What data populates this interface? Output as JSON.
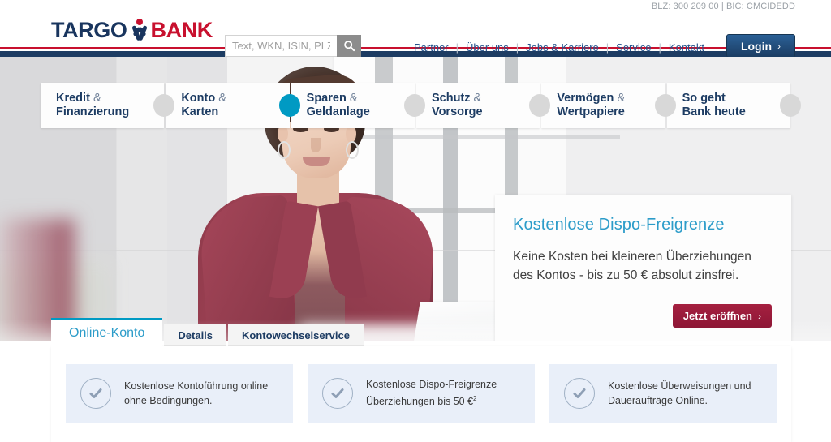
{
  "utility": {
    "blz_bic": "BLZ: 300 209 00 | BIC: CMCIDEDD"
  },
  "brand": {
    "name_part1": "TARGO",
    "name_part2": "BANK",
    "navy": "#1d3c63",
    "red": "#c8102e",
    "accent_cyan": "#009ac3"
  },
  "search": {
    "placeholder": "Text, WKN, ISIN, PLZ",
    "value": "",
    "button_icon": "search-icon"
  },
  "topnav": {
    "items": [
      {
        "label": "Partner"
      },
      {
        "label": "Über uns"
      },
      {
        "label": "Jobs & Karriere"
      },
      {
        "label": "Service"
      },
      {
        "label": "Kontakt"
      }
    ],
    "separator": "|",
    "login_label": "Login",
    "login_chevron": "›"
  },
  "mainnav": {
    "items": [
      {
        "line1": "Kredit",
        "amp": "&",
        "line2": "Finanzierung",
        "knob": "gray"
      },
      {
        "line1": "Konto",
        "amp": "&",
        "line2": "Karten",
        "knob": "cyan"
      },
      {
        "line1": "Sparen",
        "amp": "&",
        "line2": "Geldanlage",
        "knob": "gray"
      },
      {
        "line1": "Schutz",
        "amp": "&",
        "line2": "Vorsorge",
        "knob": "gray"
      },
      {
        "line1": "Vermögen",
        "amp": "&",
        "line2": "Wertpapiere",
        "knob": "gray"
      },
      {
        "line1": "So geht",
        "amp": "",
        "line2": "Bank heute",
        "knob": "gray"
      }
    ]
  },
  "promo": {
    "title": "Kostenlose Dispo-Freigrenze",
    "text_line1": "Keine Kosten bei kleineren Überziehungen",
    "text_line2": "des Kontos - bis zu 50 € absolut zinsfrei.",
    "button_label": "Jetzt eröffnen",
    "button_chevron": "›"
  },
  "hero_image": {
    "description": "Woman in burgundy blazer at a laptop in a bright office"
  },
  "panel": {
    "tabs": [
      {
        "label": "Online-Konto",
        "active": true
      },
      {
        "label": "Details",
        "active": false
      },
      {
        "label": "Kontowechselservice",
        "active": false
      }
    ],
    "features": [
      {
        "icon": "check-circle-icon",
        "line1": "Kostenlose Kontoführung online",
        "line2": "ohne Bedingungen.",
        "sup": ""
      },
      {
        "icon": "check-circle-icon",
        "line1": "Kostenlose Dispo-Freigrenze",
        "line2": "Überziehungen bis 50 €",
        "sup": "2"
      },
      {
        "icon": "check-circle-icon",
        "line1": "Kostenlose Überweisungen und",
        "line2": "Daueraufträge Online.",
        "sup": ""
      }
    ]
  }
}
